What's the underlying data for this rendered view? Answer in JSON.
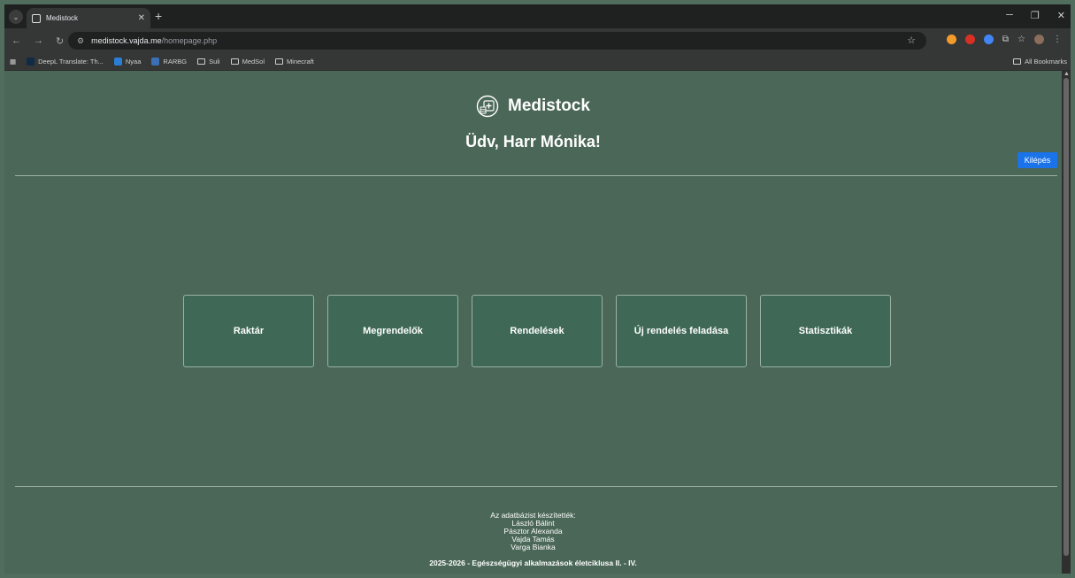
{
  "browser": {
    "tab_title": "Medistock",
    "url_host": "medistock.vajda.me",
    "url_path": "/homepage.php",
    "bookmarks": [
      "DeepL Translate: Th...",
      "Nyaa",
      "RARBG",
      "Suli",
      "MedSol",
      "Minecraft"
    ],
    "all_bookmarks_label": "All Bookmarks"
  },
  "header": {
    "brand": "Medistock",
    "greeting": "Üdv, Harr Mónika!",
    "logout_label": "Kilépés"
  },
  "menu": {
    "items": [
      "Raktár",
      "Megrendelők",
      "Rendelések",
      "Új rendelés feladása",
      "Statisztikák"
    ]
  },
  "footer": {
    "credits_title": "Az adatbázist készítették:",
    "authors": [
      "László Bálint",
      "Pásztor Alexanda",
      "Vajda Tamás",
      "Varga Bianka"
    ],
    "copyright": "2025-2026 - Egészségügyi alkalmazások életciklusa II. - IV."
  },
  "colors": {
    "page_background": "#4a6757",
    "card_background": "#3f6956",
    "logout_button": "#1a73e8"
  }
}
